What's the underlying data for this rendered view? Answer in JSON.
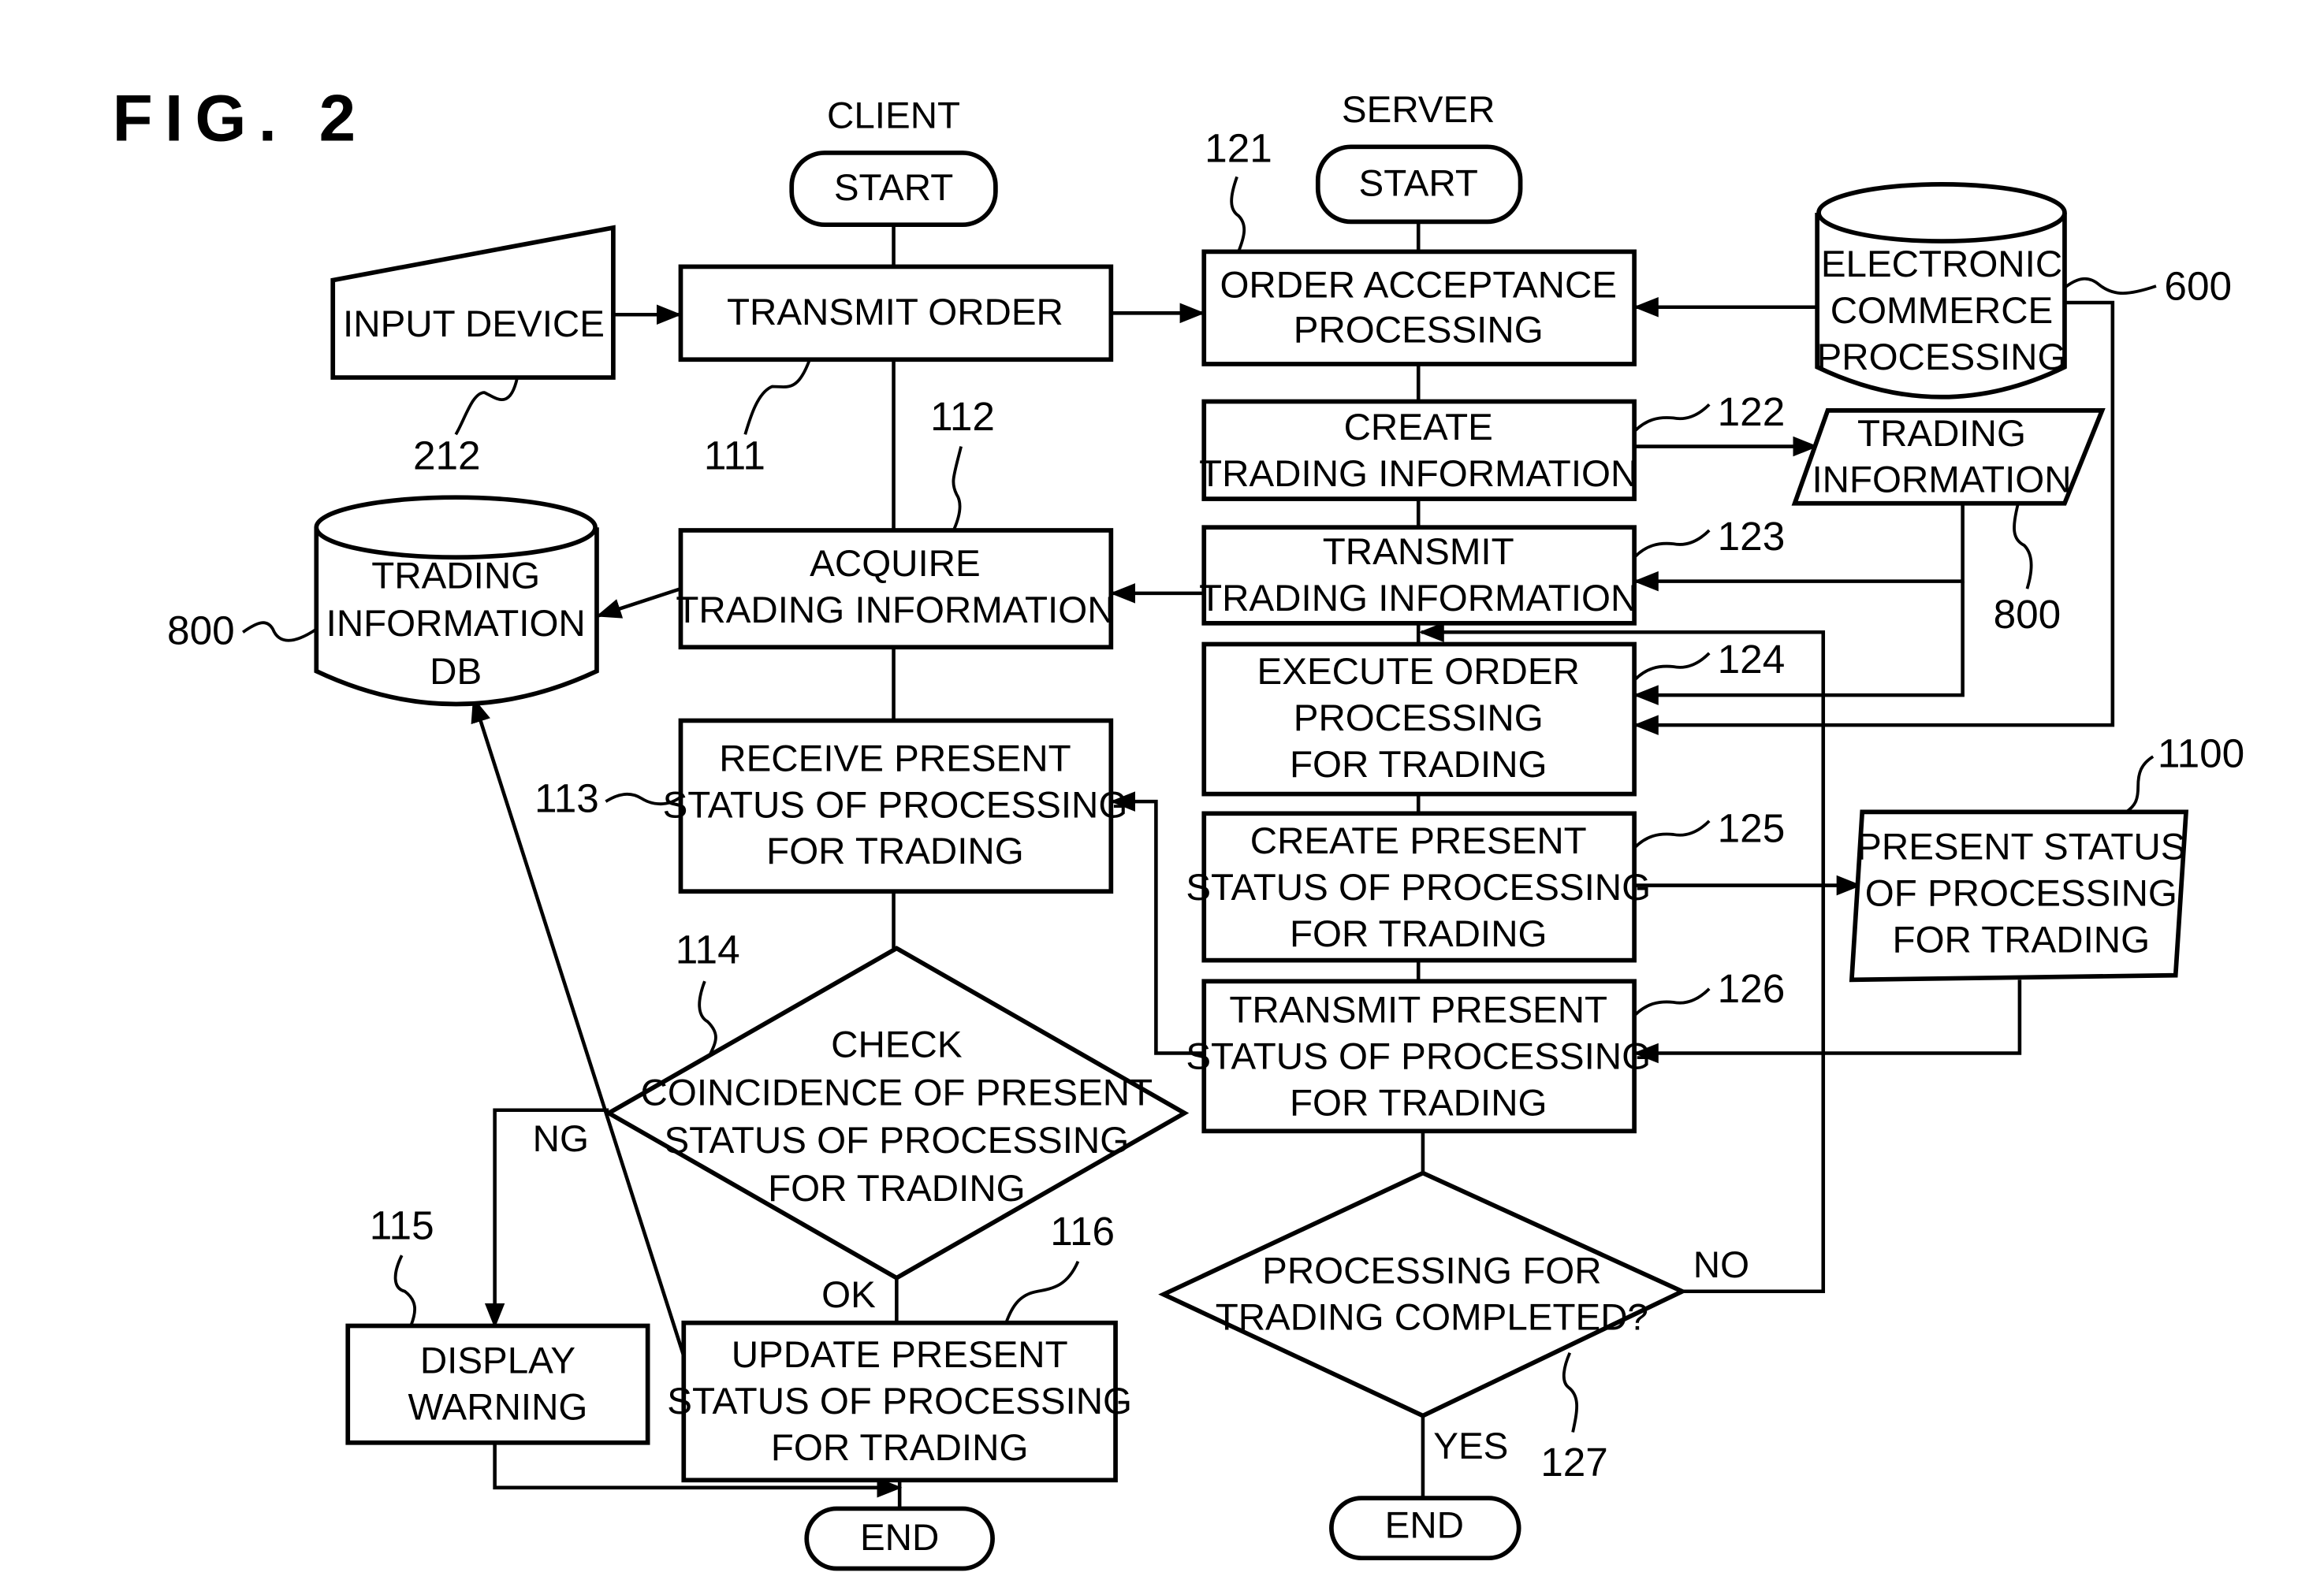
{
  "figure": {
    "title": "FIG. 2",
    "lanes": {
      "client": "CLIENT",
      "server": "SERVER"
    }
  },
  "client": {
    "start": "START",
    "end": "END",
    "steps": {
      "s111": {
        "ref": "111",
        "lines": [
          "TRANSMIT ORDER"
        ]
      },
      "s112": {
        "ref": "112",
        "lines": [
          "ACQUIRE",
          "TRADING INFORMATION"
        ]
      },
      "s113": {
        "ref": "113",
        "lines": [
          "RECEIVE PRESENT",
          "STATUS OF PROCESSING",
          "FOR TRADING"
        ]
      },
      "s114": {
        "ref": "114",
        "lines": [
          "CHECK",
          "COINCIDENCE OF PRESENT",
          "STATUS OF PROCESSING",
          "FOR TRADING"
        ],
        "ng_label": "NG",
        "ok_label": "OK"
      },
      "s115": {
        "ref": "115",
        "lines": [
          "DISPLAY",
          "WARNING"
        ]
      },
      "s116": {
        "ref": "116",
        "lines": [
          "UPDATE PRESENT",
          "STATUS OF PROCESSING",
          "FOR TRADING"
        ]
      }
    },
    "input_device": {
      "ref": "212",
      "lines": [
        "INPUT DEVICE"
      ]
    },
    "trading_db": {
      "ref": "800",
      "lines": [
        "TRADING",
        "INFORMATION",
        "DB"
      ]
    }
  },
  "server": {
    "start": "START",
    "end": "END",
    "steps": {
      "s121": {
        "ref": "121",
        "lines": [
          "ORDER ACCEPTANCE",
          "PROCESSING"
        ]
      },
      "s122": {
        "ref": "122",
        "lines": [
          "CREATE",
          "TRADING INFORMATION"
        ]
      },
      "s123": {
        "ref": "123",
        "lines": [
          "TRANSMIT",
          "TRADING INFORMATION"
        ]
      },
      "s124": {
        "ref": "124",
        "lines": [
          "EXECUTE ORDER",
          "PROCESSING",
          "FOR TRADING"
        ]
      },
      "s125": {
        "ref": "125",
        "lines": [
          "CREATE PRESENT",
          "STATUS OF PROCESSING",
          "FOR TRADING"
        ]
      },
      "s126": {
        "ref": "126",
        "lines": [
          "TRANSMIT PRESENT",
          "STATUS OF PROCESSING",
          "FOR TRADING"
        ]
      },
      "s127": {
        "ref": "127",
        "lines": [
          "PROCESSING FOR",
          "TRADING COMPLETED?"
        ],
        "yes_label": "YES",
        "no_label": "NO"
      }
    },
    "ecommerce": {
      "ref": "600",
      "lines": [
        "ELECTRONIC",
        "COMMERCE",
        "PROCESSING"
      ]
    },
    "trading_info": {
      "ref": "800",
      "lines": [
        "TRADING",
        "INFORMATION"
      ]
    },
    "present_status": {
      "ref": "1100",
      "lines": [
        "PRESENT STATUS",
        "OF PROCESSING",
        "FOR TRADING"
      ]
    }
  }
}
